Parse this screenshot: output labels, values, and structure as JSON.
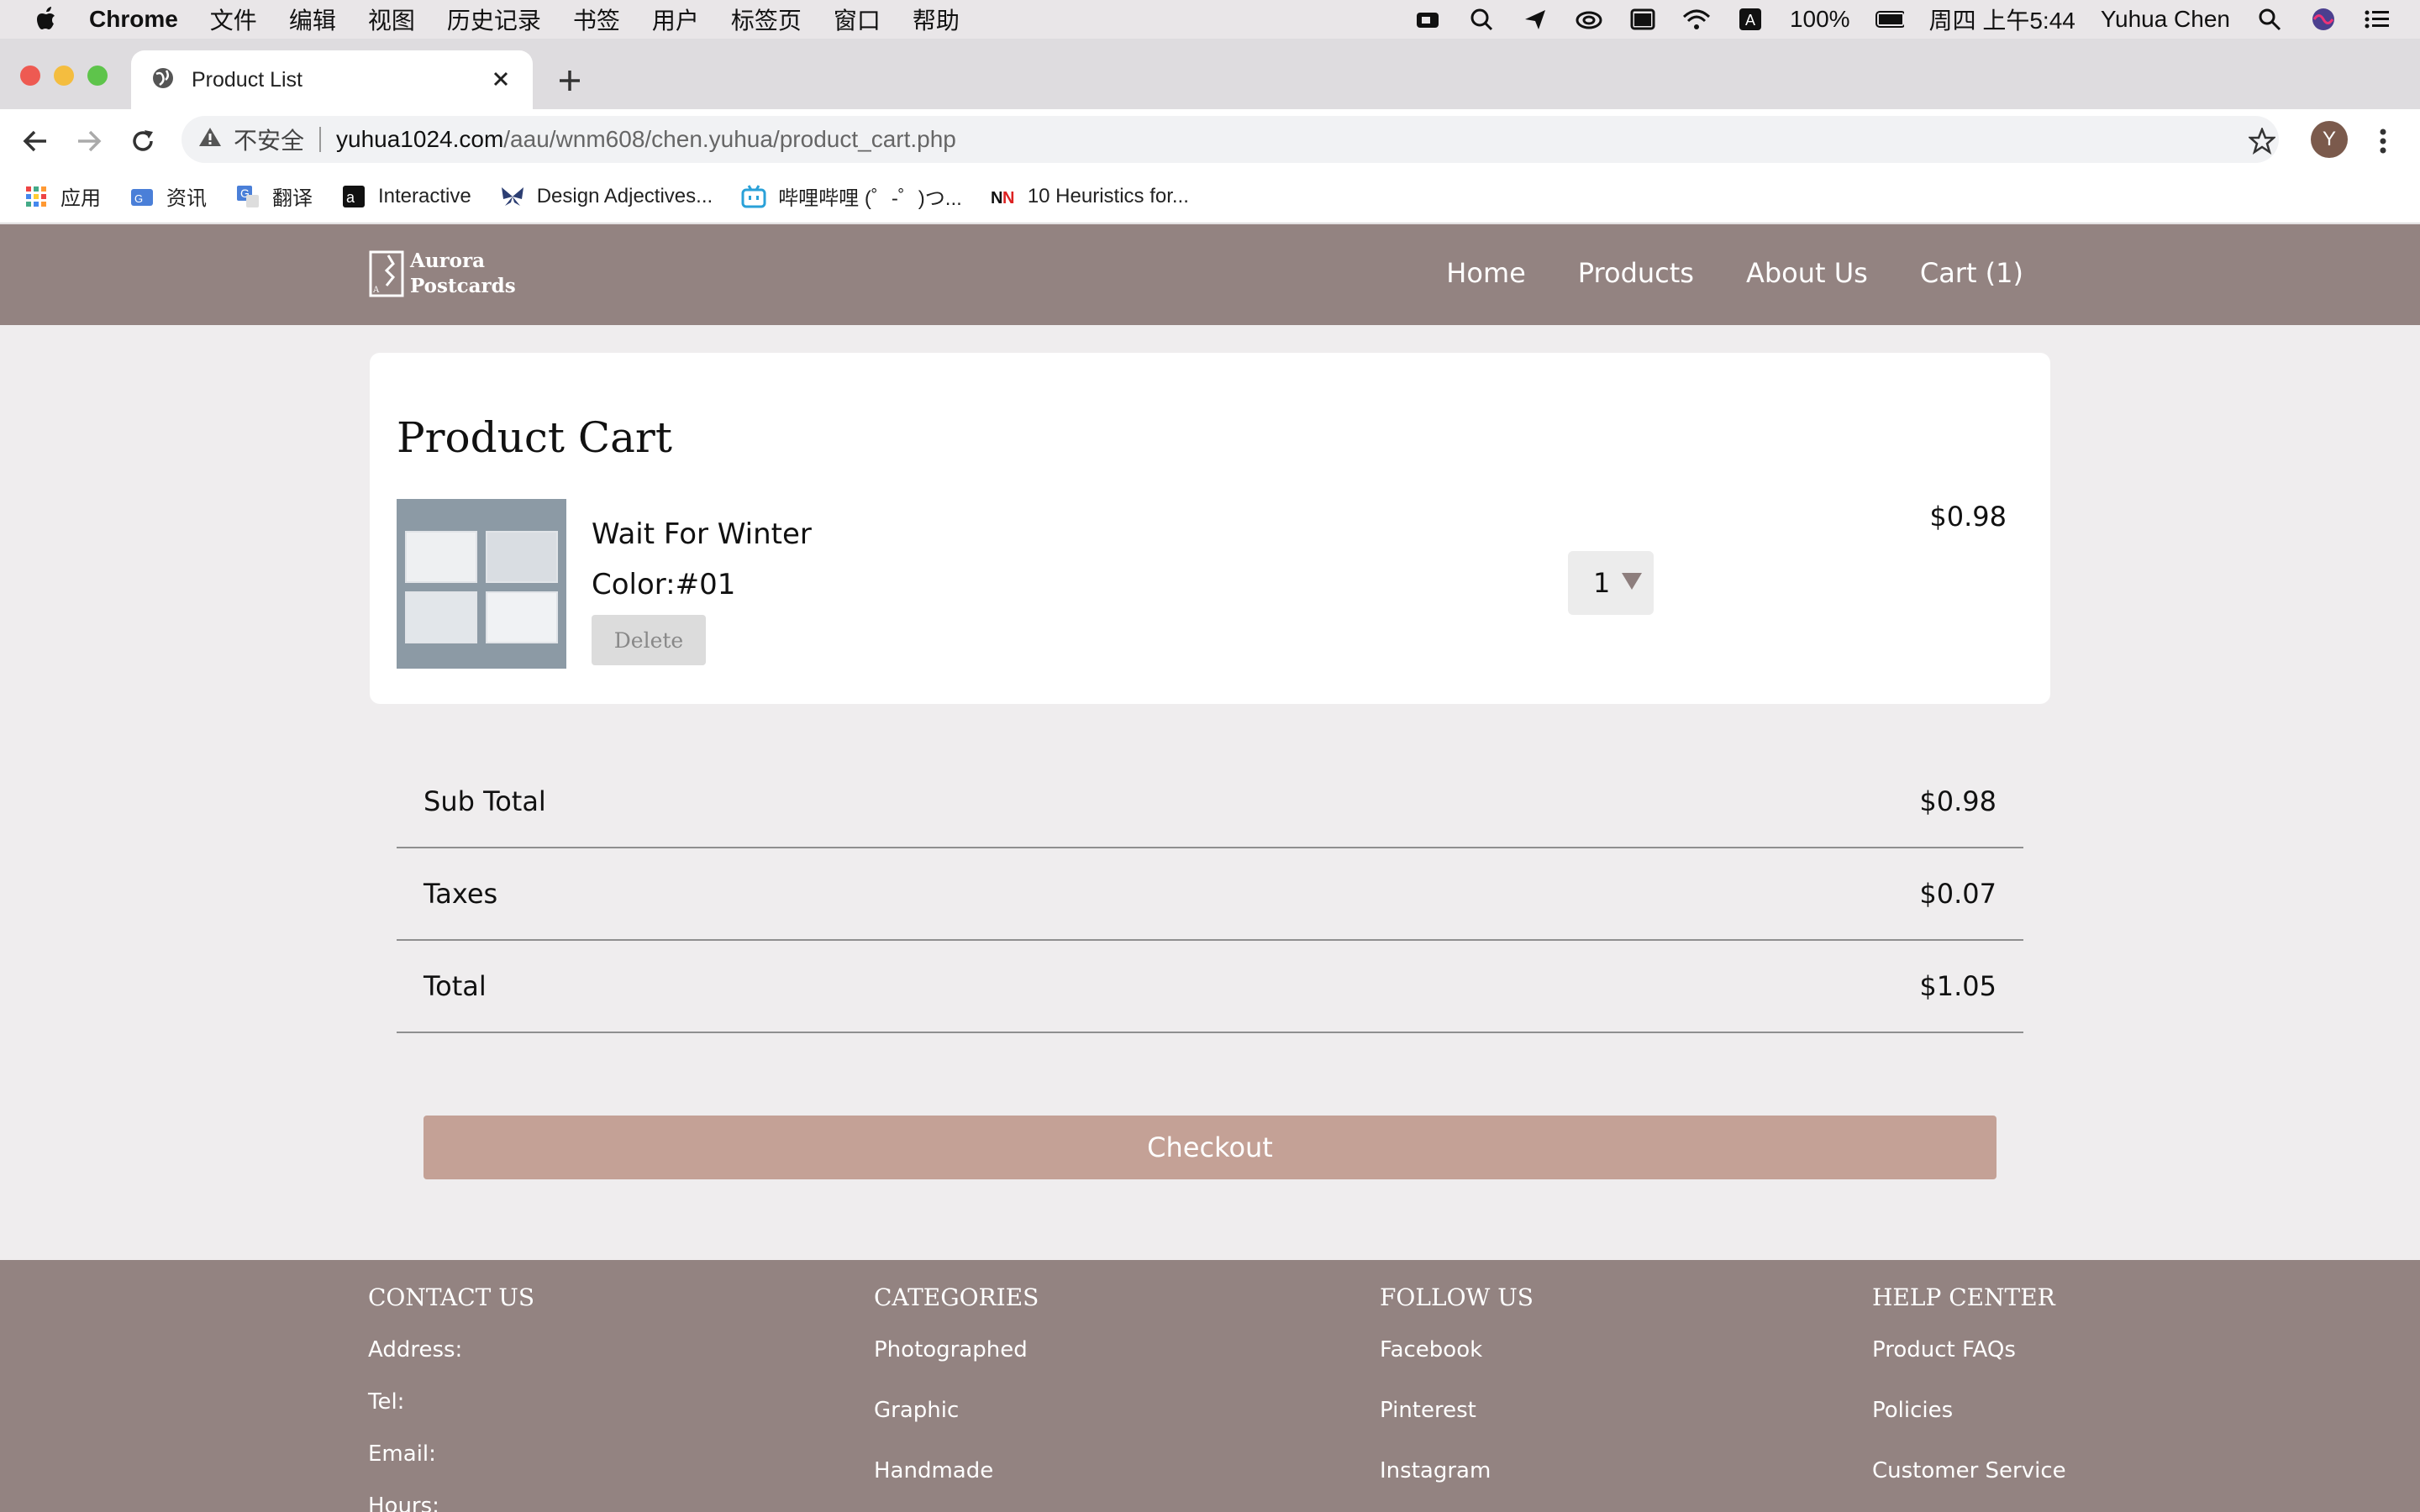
{
  "menubar": {
    "app": "Chrome",
    "items": [
      "文件",
      "编辑",
      "视图",
      "历史记录",
      "书签",
      "用户",
      "标签页",
      "窗口",
      "帮助"
    ],
    "battery": "100%",
    "datetime": "周四 上午5:44",
    "user": "Yuhua Chen"
  },
  "browser": {
    "tab_title": "Product List",
    "not_secure": "不安全",
    "url_host": "yuhua1024.com",
    "url_path": "/aau/wnm608/chen.yuhua/product_cart.php",
    "profile_initial": "Y",
    "bookmarks": [
      {
        "label": "应用",
        "icon": "apps-grid-icon"
      },
      {
        "label": "资讯",
        "icon": "news-icon"
      },
      {
        "label": "翻译",
        "icon": "translate-icon"
      },
      {
        "label": "Interactive",
        "icon": "interactive-icon"
      },
      {
        "label": "Design Adjectives...",
        "icon": "butterfly-icon"
      },
      {
        "label": "哔哩哔哩 (゜-゜)つ...",
        "icon": "bilibili-icon"
      },
      {
        "label": "10 Heuristics for...",
        "icon": "nn-icon"
      }
    ]
  },
  "site": {
    "logo_line1": "Aurora",
    "logo_line2": "Postcards",
    "nav": [
      "Home",
      "Products",
      "About Us",
      "Cart (1)"
    ]
  },
  "cart": {
    "title": "Product Cart",
    "item": {
      "name": "Wait For Winter",
      "color": "Color:#01",
      "delete_label": "Delete",
      "price": "$0.98",
      "quantity": "1"
    },
    "summary": [
      {
        "label": "Sub Total",
        "value": "$0.98"
      },
      {
        "label": "Taxes",
        "value": "$0.07"
      },
      {
        "label": "Total",
        "value": "$1.05"
      }
    ],
    "checkout_label": "Checkout"
  },
  "footer": {
    "contact": {
      "heading": "CONTACT US",
      "items": [
        "Address:",
        "Tel:",
        "Email:",
        "Hours:"
      ]
    },
    "categories": {
      "heading": "CATEGORIES",
      "items": [
        "Photographed",
        "Graphic",
        "Handmade"
      ]
    },
    "follow": {
      "heading": "FOLLOW US",
      "items": [
        "Facebook",
        "Pinterest",
        "Instagram"
      ]
    },
    "help": {
      "heading": "HELP CENTER",
      "items": [
        "Product FAQs",
        "Policies",
        "Customer Service"
      ]
    }
  },
  "colors": {
    "header_bg": "#938381",
    "checkout_bg": "#c4a196",
    "page_bg": "#efedee"
  }
}
